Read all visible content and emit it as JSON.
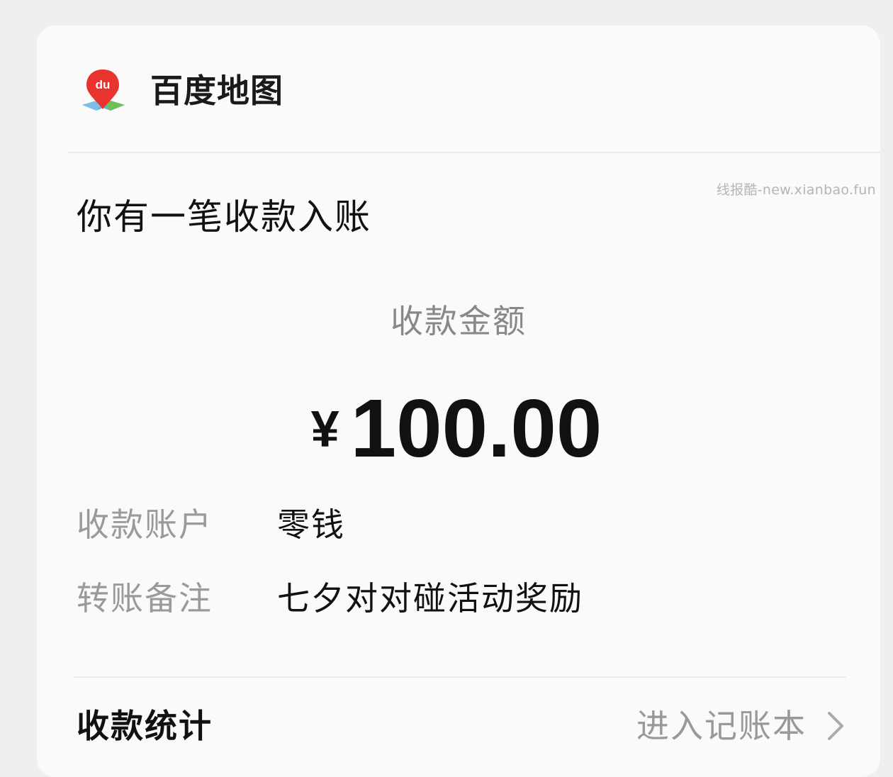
{
  "header": {
    "app_name": "百度地图",
    "logo_icon": "baidu-map-logo-icon",
    "logo_text": "du"
  },
  "watermark": "线报酷-new.xianbao.fun",
  "notice": {
    "title": "你有一笔收款入账"
  },
  "payment": {
    "amount_label": "收款金额",
    "currency_symbol": "¥",
    "amount": "100.00"
  },
  "details": [
    {
      "label": "收款账户",
      "value": "零钱"
    },
    {
      "label": "转账备注",
      "value": "七夕对对碰活动奖励"
    }
  ],
  "footer": {
    "stats_label": "收款统计",
    "link_label": "进入记账本",
    "link_icon": "chevron-right-icon"
  },
  "colors": {
    "logo_red": "#e8332f",
    "logo_blue": "#4a9fd8",
    "logo_green": "#6cc24a"
  }
}
